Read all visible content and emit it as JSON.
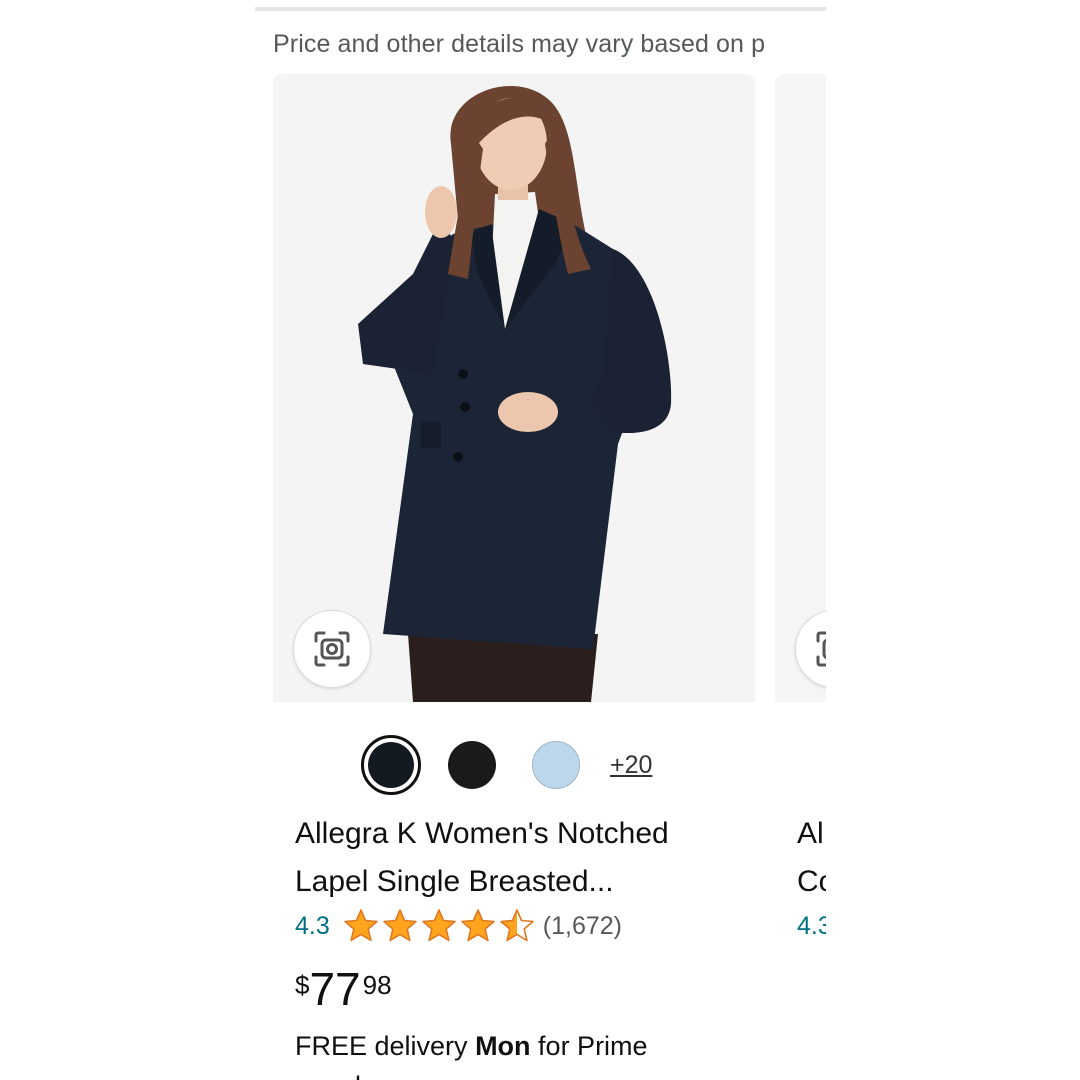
{
  "disclaimer": "Price and other details may vary based on p",
  "product": {
    "title_line1": "Allegra K Women's Notched",
    "title_line2": "Lapel Single Breasted...",
    "rating": "4.3",
    "stars_filled": 4.3,
    "review_count": "(1,672)",
    "price_symbol": "$",
    "price_whole": "77",
    "price_fraction": "98",
    "delivery_prefix": "FREE delivery ",
    "delivery_day": "Mon",
    "delivery_suffix": " for Prime",
    "delivery_line2": "members",
    "more_colors": "+20",
    "swatch_colors": [
      "#131a22",
      "#1a1a1a",
      "#bcd6eb"
    ],
    "lens_icon": "camera-lens-icon"
  },
  "next_product": {
    "title_line1": "Al",
    "title_line2": "Co",
    "rating": "4.3"
  },
  "colors": {
    "link": "#007185",
    "star": "#ffa41c",
    "text": "#0f1111",
    "muted": "#565959"
  }
}
